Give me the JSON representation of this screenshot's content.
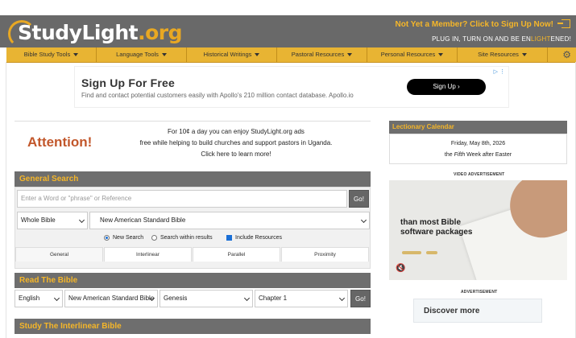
{
  "header": {
    "logo_part1": "StudyLight",
    "logo_part2": ".org",
    "signup_cta": "Not Yet a Member?  Click to Sign Up Now!",
    "signin_icon": "sign-in-icon",
    "tagline_pre": "PLUG IN, TURN ON AND BE EN",
    "tagline_light": "LIGHT",
    "tagline_post": "ENED!",
    "brand_color": "#e8a823",
    "header_bg": "#696969"
  },
  "nav": {
    "items": [
      {
        "label": "Bible Study Tools"
      },
      {
        "label": "Language Tools"
      },
      {
        "label": "Historical Writings"
      },
      {
        "label": "Pastoral Resources"
      },
      {
        "label": "Personal Resources"
      },
      {
        "label": "Site Resources"
      }
    ],
    "gear_icon": "gear-icon",
    "bar_color": "#e8b433"
  },
  "ad_banner": {
    "title": "Sign Up For Free",
    "subtitle": "Find and contact potential customers easily with Apollo's 210 million contact database. Apollo.io",
    "button": "Sign Up  ›",
    "flag": "▷ ⋮"
  },
  "attention": {
    "word": "Attention!",
    "line1": "For 10¢ a day you can enjoy StudyLight.org ads",
    "line2": "free while helping to build churches and support pastors in Uganda.",
    "line3": "Click here to learn more!"
  },
  "general_search": {
    "title": "General Search",
    "placeholder": "Enter a Word or \"phrase\" or Reference",
    "go": "Go!",
    "scope": "Whole Bible",
    "version": "New American Standard Bible",
    "radio_new": "New Search",
    "radio_within": "Search within results",
    "include_resources": "Include Resources",
    "tabs": [
      "General",
      "Interlinear",
      "Parallel",
      "Proximity"
    ]
  },
  "read_bible": {
    "title": "Read The Bible",
    "language": "English",
    "version": "New American Standard Bible",
    "book": "Genesis",
    "chapter": "Chapter 1",
    "go": "Go!"
  },
  "next_section": {
    "title": "Study The Interlinear Bible"
  },
  "sidebar": {
    "lectionary_title": "Lectionary Calendar",
    "date": "Friday, May 8th, 2026",
    "week_pre": "the ",
    "week_em": "Fifth",
    "week_post": " Week after Easter",
    "video_ad_label": "VIDEO ADVERTISEMENT",
    "video_text_line1": "than most Bible",
    "video_text_line2": "software packages",
    "mute_icon": "mute-icon",
    "ad_label": "ADVERTISEMENT",
    "discover": "Discover more"
  }
}
